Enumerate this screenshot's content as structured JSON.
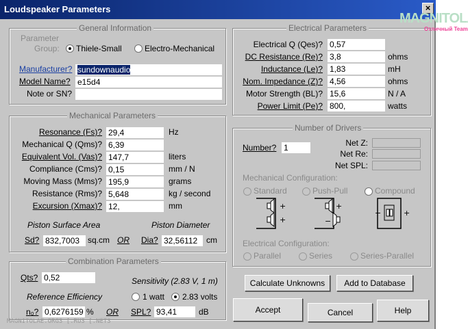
{
  "window": {
    "title": "Loudspeaker Parameters"
  },
  "watermark": {
    "logo": "MAGNITOLA",
    "team": "Отличный Team",
    "footer": "MAGNITOLAE.ORG3 [.RU3 [.NET3"
  },
  "general": {
    "legend": "General Information",
    "param_group_label_1": "Parameter",
    "param_group_label_2": "Group:",
    "opt_thiele": "Thiele-Small",
    "opt_electro": "Electro-Mechanical",
    "manufacturer_label": "Manufacturer?",
    "manufacturer_value": "sundownaudio",
    "model_label": "Model Name?",
    "model_value": "e15d4",
    "note_label": "Note or SN?",
    "note_value": ""
  },
  "electrical": {
    "legend": "Electrical Parameters",
    "rows": [
      {
        "label": "Electrical Q (Qes)?",
        "value": "0,57",
        "unit": ""
      },
      {
        "label": "DC Resistance (Re)?",
        "value": "3,8",
        "unit": "ohms"
      },
      {
        "label": "Inductance (Le)?",
        "value": "1,83",
        "unit": "mH"
      },
      {
        "label": "Nom. Impedance (Z)?",
        "value": "4,56",
        "unit": "ohms"
      },
      {
        "label": "Motor Strength (BL)?",
        "value": "15,6",
        "unit": "N / A"
      },
      {
        "label": "Power Limit (Pe)?",
        "value": "800,",
        "unit": "watts"
      }
    ]
  },
  "mechanical": {
    "legend": "Mechanical Parameters",
    "rows": [
      {
        "label": "Resonance (Fs)?",
        "value": "29,4",
        "unit": "Hz"
      },
      {
        "label": "Mechanical Q (Qms)?",
        "value": "6,39",
        "unit": ""
      },
      {
        "label": "Equivalent Vol. (Vas)?",
        "value": "147,7",
        "unit": "liters"
      },
      {
        "label": "Compliance (Cms)?",
        "value": "0,15",
        "unit": "mm / N"
      },
      {
        "label": "Moving Mass (Mms)?",
        "value": "195,9",
        "unit": "grams"
      },
      {
        "label": "Resistance (Rms)?",
        "value": "5,648",
        "unit": "kg / second"
      },
      {
        "label": "Excursion (Xmax)?",
        "value": "12,",
        "unit": "mm"
      }
    ],
    "piston_area_title": "Piston Surface Area",
    "piston_diam_title": "Piston Diameter",
    "sd_label": "Sd?",
    "sd_value": "832,7003",
    "sd_unit": "sq.cm",
    "or_label": "OR",
    "dia_label": "Dia?",
    "dia_value": "32,56112",
    "dia_unit": "cm"
  },
  "combination": {
    "legend": "Combination Parameters",
    "qts_label": "Qts?",
    "qts_value": "0,52",
    "sensitivity_title": "Sensitivity (2.83 V, 1 m)",
    "ref_eff_title": "Reference Efficiency",
    "opt_1watt": "1 watt",
    "opt_283": "2.83 volts",
    "n0_label": "n₀?",
    "n0_value": "0,6276159",
    "n0_unit": "%",
    "or_label": "OR",
    "spl_label": "SPL?",
    "spl_value": "93,41",
    "spl_unit": "dB"
  },
  "drivers": {
    "legend": "Number of Drivers",
    "number_label": "Number?",
    "number_value": "1",
    "net_z": "Net Z:",
    "net_re": "Net Re:",
    "net_spl": "Net SPL:",
    "mech_config_title": "Mechanical Configuration:",
    "mech_opts": [
      "Standard",
      "Push-Pull",
      "Compound"
    ],
    "elec_config_title": "Electrical Configuration:",
    "elec_opts": [
      "Parallel",
      "Series",
      "Series-Parallel"
    ]
  },
  "buttons": {
    "calculate": "Calculate Unknowns",
    "add_db": "Add to Database",
    "accept": "Accept",
    "cancel": "Cancel",
    "help": "Help"
  }
}
